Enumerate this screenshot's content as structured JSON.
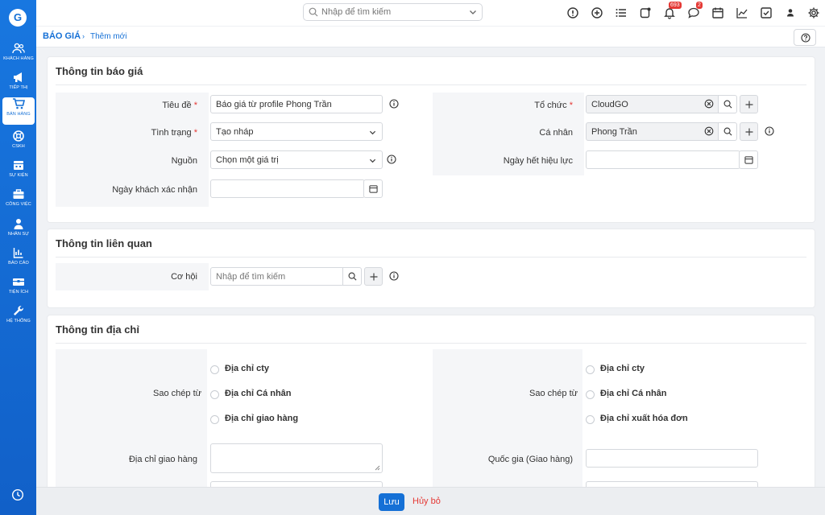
{
  "app": {
    "logo_letter": "G"
  },
  "sidebar": {
    "items": [
      {
        "label": "KHÁCH HÀNG",
        "icon": "users-icon"
      },
      {
        "label": "TIẾP THỊ",
        "icon": "megaphone-icon"
      },
      {
        "label": "BÁN HÀNG",
        "icon": "cart-icon",
        "active": true
      },
      {
        "label": "CSKH",
        "icon": "lifebuoy-icon"
      },
      {
        "label": "SỰ KIỆN",
        "icon": "calendar-icon"
      },
      {
        "label": "CÔNG VIỆC",
        "icon": "briefcase-icon"
      },
      {
        "label": "NHÂN SỰ",
        "icon": "person-icon"
      },
      {
        "label": "BÁO CÁO",
        "icon": "report-icon"
      },
      {
        "label": "TIỆN ÍCH",
        "icon": "box-icon"
      },
      {
        "label": "HỆ THỐNG",
        "icon": "wrench-icon"
      }
    ]
  },
  "topbar": {
    "search_placeholder": "Nhập để tìm kiếm",
    "notifications_count": "693",
    "messages_count": "2"
  },
  "breadcrumb": {
    "module": "BÁO GIÁ",
    "separator": "›",
    "page": "Thêm mới"
  },
  "section_quote": {
    "title": "Thông tin báo giá",
    "title_label": "Tiêu đề",
    "title_value": "Báo giá từ profile Phong Trần",
    "status_label": "Tình trạng",
    "status_value": "Tạo nháp",
    "source_label": "Nguồn",
    "source_value": "Chọn một giá trị",
    "confirm_date_label": "Ngày khách xác nhận",
    "org_label": "Tổ chức",
    "org_value": "CloudGO",
    "contact_label": "Cá nhân",
    "contact_value": "Phong Trần",
    "expiry_label": "Ngày hết hiệu lực",
    "required_mark": "*"
  },
  "section_related": {
    "title": "Thông tin liên quan",
    "opportunity_label": "Cơ hội",
    "opportunity_placeholder": "Nhập để tìm kiếm"
  },
  "section_address": {
    "title": "Thông tin địa chỉ",
    "copy_from_label": "Sao chép từ",
    "left_options": [
      "Địa chỉ cty",
      "Địa chỉ Cá nhân",
      "Địa chỉ giao hàng"
    ],
    "right_options": [
      "Địa chỉ cty",
      "Địa chỉ Cá nhân",
      "Địa chỉ xuất hóa đơn"
    ],
    "shipping_address_label": "Địa chỉ giao hàng",
    "shipping_country_label": "Quốc gia (Giao hàng)"
  },
  "footer": {
    "save_label": "Lưu",
    "cancel_label": "Hủy bỏ"
  },
  "colors": {
    "primary": "#1570d6",
    "danger": "#e53935"
  }
}
